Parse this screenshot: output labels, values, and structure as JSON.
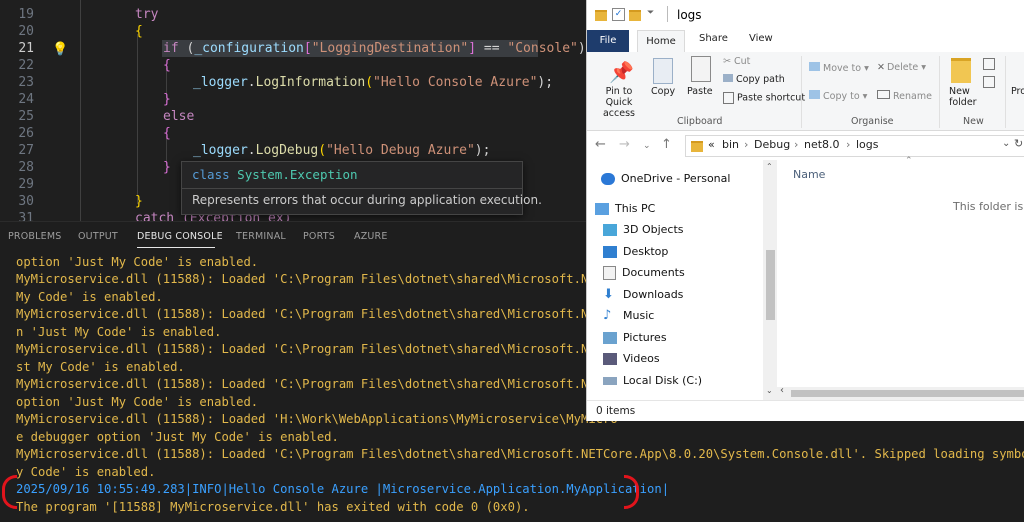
{
  "editor": {
    "line_numbers": [
      "19",
      "20",
      "21",
      "22",
      "23",
      "24",
      "25",
      "26",
      "27",
      "28",
      "29",
      "30",
      "31"
    ],
    "current_line": "21",
    "lines": {
      "try": "try",
      "open1": "{",
      "if_kw": "if",
      "if_open": " (",
      "if_cfg": "_configuration",
      "if_lb": "[",
      "if_key": "\"LoggingDestination\"",
      "if_rb": "]",
      "if_eq": " == ",
      "if_val": "\"Console\"",
      "if_close": ")",
      "open2": "{",
      "logger1": "_logger",
      "dot1": ".",
      "method1": "LogInformation",
      "paren1": "(",
      "arg1": "\"Hello Console Azure\"",
      "end1": ");",
      "close2": "}",
      "else": "else",
      "open3": "{",
      "logger2": "_logger",
      "dot2": ".",
      "method2": "LogDebug",
      "paren2": "(",
      "arg2": "\"Hello Debug Azure\"",
      "end2": ");",
      "close3": "}",
      "close1": "}",
      "catch_partial": "catch (Exception ex)"
    },
    "hover": {
      "signature_kw": "class",
      "signature_ns": "System",
      "signature_type": ".Exception",
      "description": "Represents errors that occur during application execution."
    }
  },
  "panel": {
    "tabs": [
      "PROBLEMS",
      "OUTPUT",
      "DEBUG CONSOLE",
      "TERMINAL",
      "PORTS",
      "AZURE"
    ],
    "active_tab": "DEBUG CONSOLE",
    "output_lines": [
      "option 'Just My Code' is enabled.",
      "MyMicroservice.dll (11588): Loaded 'C:\\Program Files\\dotnet\\shared\\Microsoft.NETCo",
      "My Code' is enabled.",
      "MyMicroservice.dll (11588): Loaded 'C:\\Program Files\\dotnet\\shared\\Microsoft.NETCo",
      "n 'Just My Code' is enabled.",
      "MyMicroservice.dll (11588): Loaded 'C:\\Program Files\\dotnet\\shared\\Microsoft.NETCo",
      "st My Code' is enabled.",
      "MyMicroservice.dll (11588): Loaded 'C:\\Program Files\\dotnet\\shared\\Microsoft.NETCo",
      "option 'Just My Code' is enabled.",
      "MyMicroservice.dll (11588): Loaded 'H:\\Work\\WebApplications\\MyMicroservice\\MyMicro",
      "e debugger option 'Just My Code' is enabled.",
      "MyMicroservice.dll (11588): Loaded 'C:\\Program Files\\dotnet\\shared\\Microsoft.NETCore.App\\8.0.20\\System.Console.dll'. Skipped loading symbols. Modu",
      "y Code' is enabled.",
      "2025/09/16 10:55:49.283|INFO|Hello Console Azure |Microservice.Application.MyApplication|",
      "The program '[11588] MyMicroservice.dll' has exited with code 0 (0x0)."
    ],
    "colors": {
      "loader_text": "#e2b84b",
      "log_text": "#3aa0ff",
      "annotation": "#e2141c"
    }
  },
  "explorer": {
    "title": "logs",
    "ribbon_tabs": [
      "File",
      "Home",
      "Share",
      "View"
    ],
    "clipboard": {
      "pin": "Pin to Quick access",
      "copy": "Copy",
      "paste": "Paste",
      "cut": "Cut",
      "copy_path": "Copy path",
      "paste_shortcut": "Paste shortcut",
      "group": "Clipboard"
    },
    "organise": {
      "move_to": "Move to",
      "delete": "Delete",
      "copy_to": "Copy to",
      "rename": "Rename",
      "group": "Organise"
    },
    "new": {
      "new_folder": "New folder",
      "group": "New",
      "partial": "Pro"
    },
    "breadcrumb": [
      "«",
      "bin",
      "Debug",
      "net8.0",
      "logs"
    ],
    "nav_items": [
      "OneDrive - Personal",
      "This PC",
      "3D Objects",
      "Desktop",
      "Documents",
      "Downloads",
      "Music",
      "Pictures",
      "Videos",
      "Local Disk (C:)"
    ],
    "column_name": "Name",
    "empty_message": "This folder is empty",
    "status": "0 items"
  }
}
